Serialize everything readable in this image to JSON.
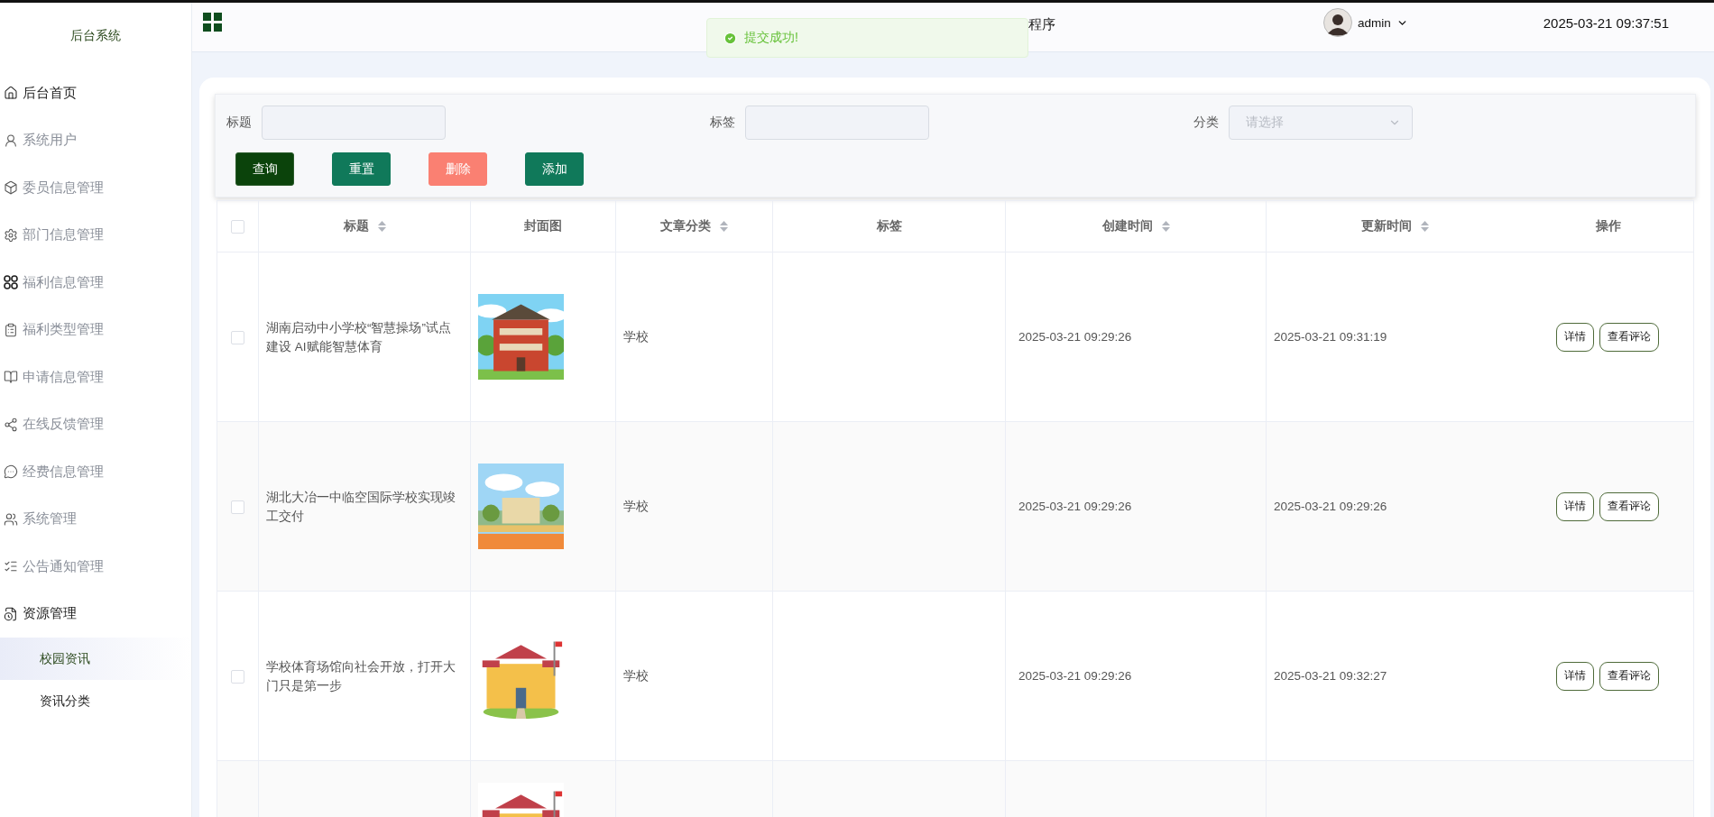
{
  "sidebar": {
    "title": "后台系统",
    "items": [
      {
        "label": "后台首页",
        "active": true
      },
      {
        "label": "系统用户",
        "active": false
      },
      {
        "label": "委员信息管理",
        "active": false
      },
      {
        "label": "部门信息管理",
        "active": false
      },
      {
        "label": "福利信息管理",
        "active": false
      },
      {
        "label": "福利类型管理",
        "active": false
      },
      {
        "label": "申请信息管理",
        "active": false
      },
      {
        "label": "在线反馈管理",
        "active": false
      },
      {
        "label": "经费信息管理",
        "active": false
      },
      {
        "label": "系统管理",
        "active": false
      },
      {
        "label": "公告通知管理",
        "active": false
      },
      {
        "label": "资源管理",
        "active": true,
        "expanded": true,
        "children": [
          {
            "label": "校园资讯",
            "selected": true
          },
          {
            "label": "资讯分类",
            "selected": false
          }
        ]
      }
    ]
  },
  "header": {
    "title": "程序",
    "user": "admin",
    "datetime": "2025-03-21 09:37:51"
  },
  "toast": {
    "kind": "success",
    "message": "提交成功!"
  },
  "search": {
    "fields": [
      {
        "label": "标题",
        "kind": "input"
      },
      {
        "label": "标签",
        "kind": "input"
      },
      {
        "label": "分类",
        "kind": "select",
        "placeholder": "请选择"
      }
    ],
    "buttons": [
      {
        "label": "查询",
        "kind": "primary"
      },
      {
        "label": "重置",
        "kind": "secondary"
      },
      {
        "label": "删除",
        "kind": "danger"
      },
      {
        "label": "添加",
        "kind": "secondary"
      }
    ]
  },
  "table": {
    "select_all": {
      "checked": false
    },
    "columns": [
      {
        "label": "标题",
        "sortable": true
      },
      {
        "label": "封面图",
        "sortable": false
      },
      {
        "label": "文章分类",
        "sortable": true
      },
      {
        "label": "标签",
        "sortable": false
      },
      {
        "label": "创建时间",
        "sortable": true
      },
      {
        "label": "更新时间",
        "sortable": true
      },
      {
        "label": "操作",
        "sortable": false
      }
    ],
    "rows": [
      {
        "checked": false,
        "title": "湖南启动中小学校“智慧操场”试点建设 AI赋能智慧体育",
        "cover": {
          "kind": "picture"
        },
        "category": "学校",
        "created": "2025-03-21 09:29:26",
        "updated": "2025-03-21 09:31:19",
        "actions": [
          "详情",
          "查看评论"
        ]
      },
      {
        "checked": false,
        "title": "湖北大冶一中临空国际学校实现竣工交付",
        "cover": {
          "kind": "picture"
        },
        "category": "学校",
        "created": "2025-03-21 09:29:26",
        "updated": "2025-03-21 09:29:26",
        "actions": [
          "详情",
          "查看评论"
        ]
      },
      {
        "checked": false,
        "title": "学校体育场馆向社会开放，打开大门只是第一步",
        "cover": {
          "kind": "picture"
        },
        "category": "学校",
        "created": "2025-03-21 09:29:26",
        "updated": "2025-03-21 09:32:27",
        "actions": [
          "详情",
          "查看评论"
        ]
      },
      {
        "cover": {
          "kind": "picture"
        }
      }
    ]
  }
}
